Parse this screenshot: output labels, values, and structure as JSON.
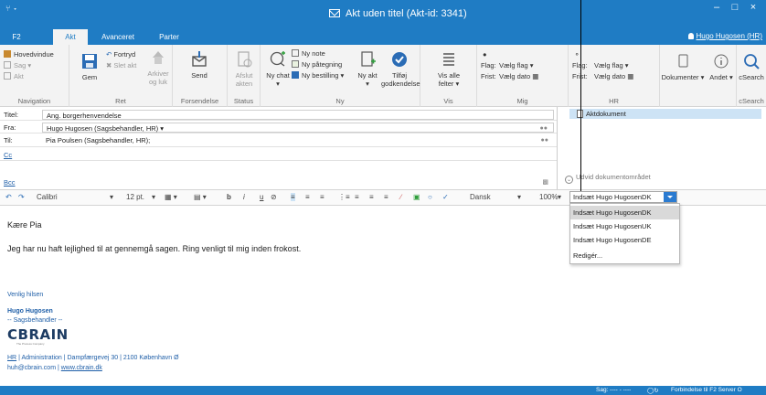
{
  "window": {
    "title": "Akt uden titel (Akt-id: 3341)",
    "quick_access": "⑂  ▾"
  },
  "tabs": [
    {
      "label": "F2"
    },
    {
      "label": "Akt"
    },
    {
      "label": "Avanceret"
    },
    {
      "label": "Parter"
    }
  ],
  "user": "Hugo Hugosen (HR)",
  "ribbon": {
    "navigation": {
      "label": "Navigation",
      "hovedvindue": "Hovedvindue",
      "sag": "Sag ▾",
      "akt": "Akt"
    },
    "ret": {
      "label": "Ret",
      "gem": "Gem",
      "fortryd": "Fortryd",
      "slet_akt": "Slet akt",
      "arkiver": "Arkiver og luk"
    },
    "forsendelse": {
      "label": "Forsendelse",
      "send": "Send"
    },
    "status": {
      "label": "Status",
      "afslut": "Afslut akten"
    },
    "ny": {
      "label": "Ny",
      "ny_chat": "Ny chat ▾",
      "ny_note": "Ny note",
      "ny_paategning": "Ny påtegning",
      "ny_bestilling": "Ny bestilling ▾",
      "ny_akt": "Ny akt ▾",
      "tilfoej_godkendelse": "Tilføj godkendelse"
    },
    "vis": {
      "label": "Vis",
      "vis_alle": "Vis alle felter ▾"
    },
    "mig": {
      "label": "Mig",
      "flag": "Flag:",
      "frist": "Frist:",
      "vaelg_flag": "Vælg flag",
      "vaelg_dato": "Vælg dato"
    },
    "hr": {
      "label": "HR",
      "flag": "Flag:",
      "frist": "Frist:",
      "vaelg_flag": "Vælg flag",
      "vaelg_dato": "Vælg dato"
    },
    "dokumenter": "Dokumenter ▾",
    "andet": "Andet ▾",
    "csearch": {
      "label": "cSearch",
      "btn": "cSearch"
    }
  },
  "form": {
    "titel_label": "Titel:",
    "titel_value": "Ang. borgerhenvendelse",
    "fra_label": "Fra:",
    "fra_value": "Hugo Hugosen (Sagsbehandler, HR) ▾",
    "til_label": "Til:",
    "til_value": "Pia Poulsen (Sagsbehandler, HR);",
    "cc_label": "Cc",
    "bcc_label": "Bcc"
  },
  "right_pane": {
    "aktdokument": "Aktdokument",
    "expand": "Udvid dokumentområdet"
  },
  "format_toolbar": {
    "font": "Calibri",
    "size": "12 pt.",
    "language": "Dansk",
    "zoom": "100%"
  },
  "insert_combo": {
    "selected": "Indsæt Hugo HugosenDK",
    "options": [
      "Indsæt Hugo HugosenDK",
      "Indsæt Hugo HugosenUK",
      "Indsæt Hugo HugosenDE",
      "Redigér..."
    ]
  },
  "body": {
    "greeting": "Kære Pia",
    "message": "Jeg har nu haft lejlighed til at gennemgå sagen. Ring venligt til mig inden frokost.",
    "closing": "Venlig hilsen",
    "sig_name": "Hugo Hugosen",
    "sig_role": "-- Sagsbehandler --",
    "logo": "CBRAIN",
    "logo_tag": "The Process Company",
    "sig_dept_link": "HR",
    "sig_address": " | Administration | Dampfærgevej 30 | 2100 København Ø",
    "sig_email": "huh@cbrain.com",
    "sig_sep": " | ",
    "sig_web": "www.cbrain.dk"
  },
  "status_bar": {
    "left": "Sag: ---- - ----",
    "right": "Forbindelse til F2 Server O"
  },
  "colors": {
    "accent": "#1f7cc4",
    "link": "#1f5fa8",
    "selection": "#cde3f5"
  }
}
